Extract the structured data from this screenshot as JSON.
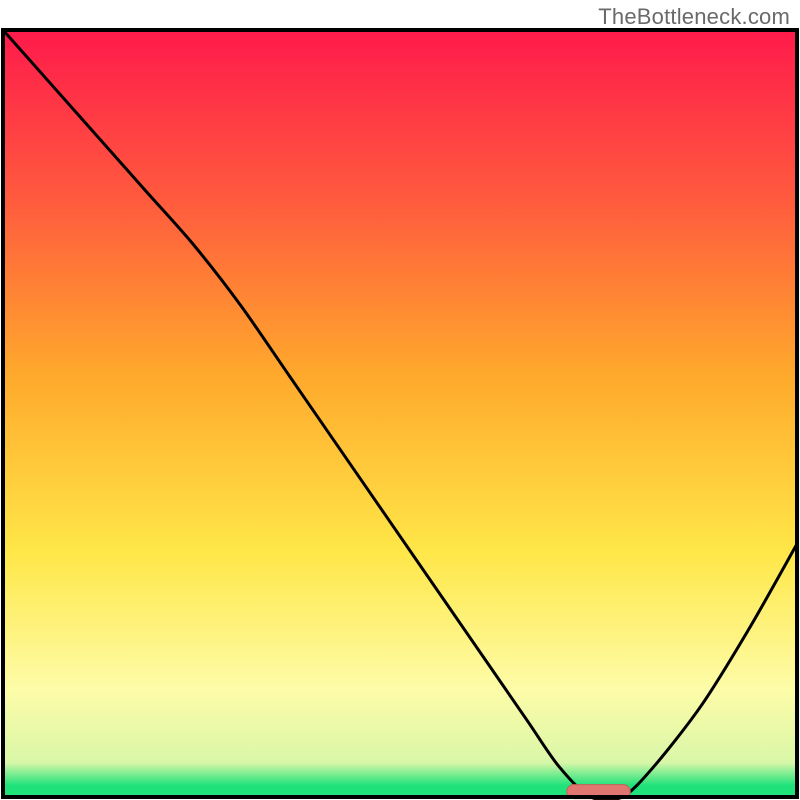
{
  "watermark": "TheBottleneck.com",
  "colors": {
    "grad_top": "#ff1a4b",
    "grad_mid_upper": "#ff6a3c",
    "grad_mid": "#ffb02a",
    "grad_mid_lower": "#ffe748",
    "grad_pale": "#fffcc0",
    "grad_green": "#1fe27a",
    "curve": "#000000",
    "marker_fill": "#e0766f",
    "marker_stroke": "#c95d56",
    "frame": "#000000"
  },
  "chart_data": {
    "type": "line",
    "title": "",
    "xlabel": "",
    "ylabel": "",
    "xlim": [
      0,
      100
    ],
    "ylim": [
      0,
      100
    ],
    "series": [
      {
        "name": "bottleneck-curve",
        "x": [
          0,
          6,
          12,
          18,
          24,
          30,
          36,
          42,
          48,
          54,
          60,
          66,
          70,
          74,
          78,
          82,
          88,
          94,
          100
        ],
        "values": [
          100,
          93,
          86,
          79,
          72,
          64,
          55,
          46,
          37,
          28,
          19,
          10,
          4,
          0,
          0,
          4,
          12,
          22,
          33
        ]
      }
    ],
    "marker": {
      "name": "optimal-range",
      "x_start": 71,
      "x_end": 79,
      "y": 0.7
    },
    "background_gradient_stops": [
      {
        "pos": 0.0,
        "color": "#ff1a4b"
      },
      {
        "pos": 0.22,
        "color": "#ff5a3e"
      },
      {
        "pos": 0.45,
        "color": "#ffa92c"
      },
      {
        "pos": 0.68,
        "color": "#ffe748"
      },
      {
        "pos": 0.86,
        "color": "#fdfca8"
      },
      {
        "pos": 0.955,
        "color": "#d9f7a8"
      },
      {
        "pos": 0.985,
        "color": "#1fe27a"
      },
      {
        "pos": 1.0,
        "color": "#1fe27a"
      }
    ]
  }
}
